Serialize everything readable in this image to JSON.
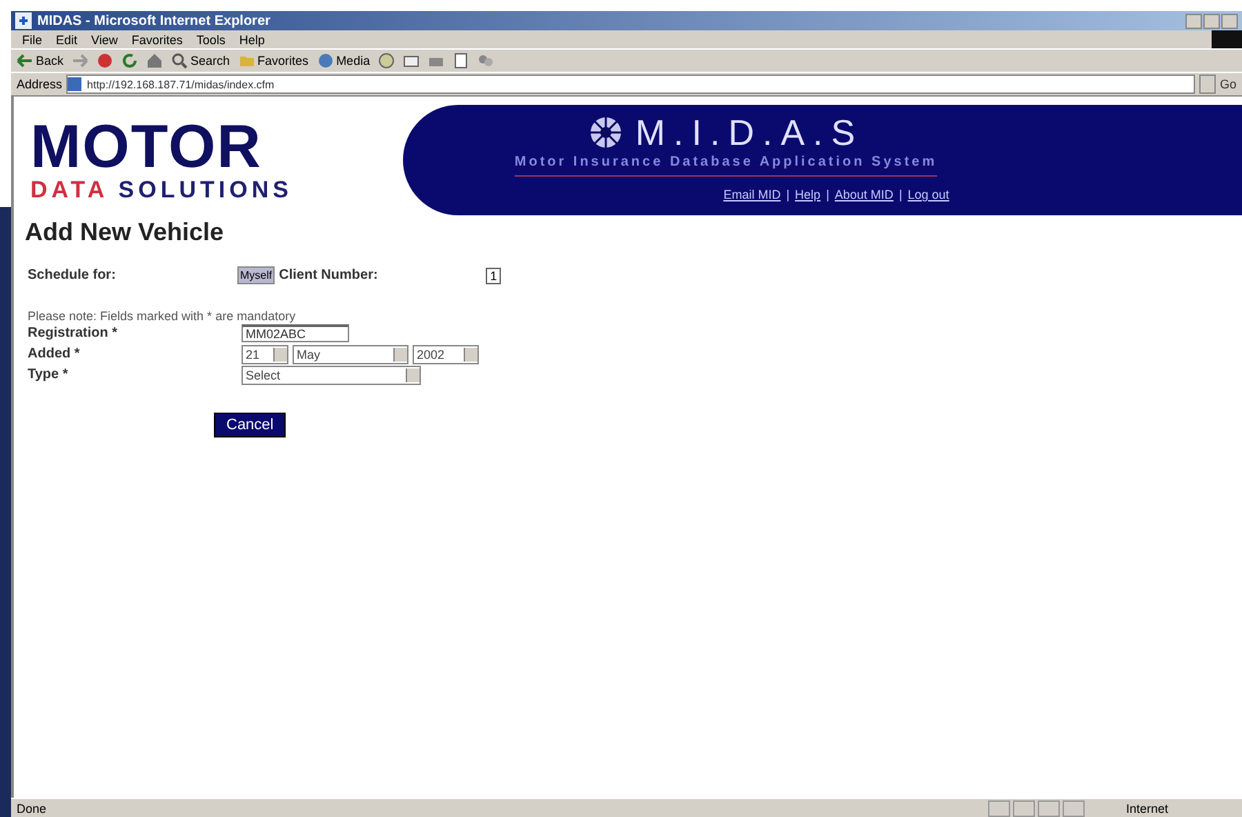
{
  "window": {
    "title": "MIDAS - Microsoft Internet Explorer"
  },
  "menu": [
    "File",
    "Edit",
    "View",
    "Favorites",
    "Tools",
    "Help"
  ],
  "toolbar": [
    {
      "kind": "back",
      "label": "Back"
    },
    {
      "kind": "forward"
    },
    {
      "kind": "stop"
    },
    {
      "kind": "refresh"
    },
    {
      "kind": "home"
    },
    {
      "kind": "search",
      "label": "Search"
    },
    {
      "kind": "favorites",
      "label": "Favorites"
    },
    {
      "kind": "media",
      "label": "Media"
    },
    {
      "kind": "history"
    },
    {
      "kind": "mail"
    },
    {
      "kind": "print"
    },
    {
      "kind": "edit"
    },
    {
      "kind": "discuss"
    }
  ],
  "address": {
    "label": "Address",
    "value": "http://192.168.187.71/midas/index.cfm",
    "go": "Go"
  },
  "header": {
    "logo_top": "MOTOR",
    "logo_bottom_1": "DATA",
    "logo_bottom_2": "SOLUTIONS",
    "app_name": "M.I.D.A.S",
    "app_subtitle": "Motor Insurance Database Application System",
    "links": [
      "Email MID",
      "Help",
      "About MID",
      "Log out"
    ],
    "separator": "|"
  },
  "page": {
    "heading": "Add New Vehicle",
    "schedule_label": "Schedule for:",
    "schedule_button": "Myself",
    "client_label": "Client Number:",
    "client_value": "1",
    "note": "Please note: Fields marked with * are mandatory",
    "fields": [
      {
        "label": "Registration *",
        "kind": "text",
        "value": "MM02ABC"
      },
      {
        "label": "Added *",
        "kind": "date",
        "day": "21",
        "month": "May",
        "year": "2002"
      },
      {
        "label": "Type *",
        "kind": "select",
        "value": "Select"
      }
    ],
    "cancel": "Cancel"
  },
  "status_bar": {
    "text": "Done",
    "zone": "Internet"
  }
}
